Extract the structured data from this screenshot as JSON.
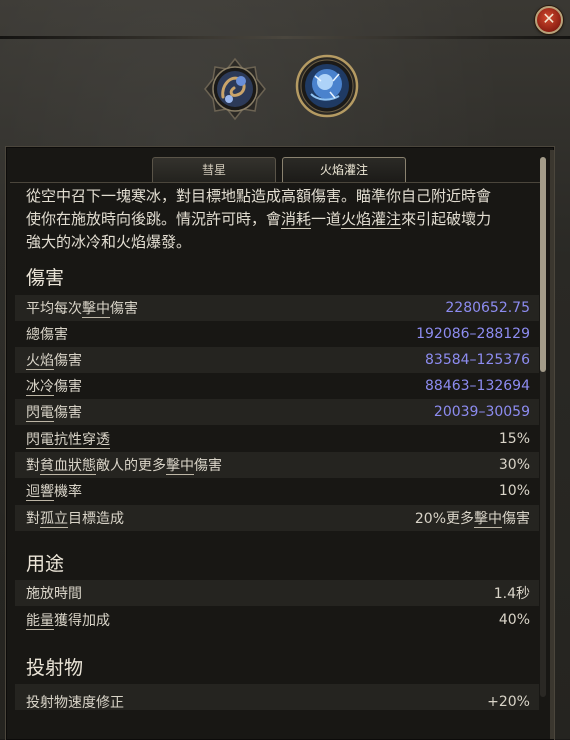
{
  "window": {
    "close_glyph": "✕"
  },
  "gems": [
    {
      "icon": "ice-serpent-gem-icon"
    },
    {
      "icon": "frost-orb-gem-icon"
    }
  ],
  "tabs": [
    {
      "label": "彗星",
      "active": false
    },
    {
      "label": "火焰灌注",
      "active": true
    }
  ],
  "description": {
    "line1": "從空中召下一塊寒冰，對目標地點造成高額傷害。瞄準你自己附近時會",
    "line2": "使你在施放時向後跳。情況許可時，會",
    "kw1": "消耗",
    "mid": "一道",
    "kw2": "火焰灌注",
    "line2_end": "來引起破壞力",
    "line3": "強大的冰冷和火焰爆發。"
  },
  "sections": {
    "damage": {
      "title": "傷害",
      "rows": [
        {
          "label_a": "平均每次",
          "label_u": "擊中",
          "label_b": "傷害",
          "value": "2280652.75"
        },
        {
          "label_a": "總傷害",
          "label_u": "",
          "label_b": "",
          "value": "192086–288129"
        },
        {
          "label_a": "",
          "label_u": "火焰",
          "label_b": "傷害",
          "value": "83584–125376"
        },
        {
          "label_a": "",
          "label_u": "冰冷",
          "label_b": "傷害",
          "value": "88463–132694"
        },
        {
          "label_a": "",
          "label_u": "閃電",
          "label_b": "傷害",
          "value": "20039–30059"
        },
        {
          "label_a": "",
          "label_u": "閃電抗性穿透",
          "label_b": "",
          "value": "15%"
        },
        {
          "label_a": "對",
          "label_u": "貧血狀態",
          "label_b": "敵人的更多",
          "label_u2": "擊中",
          "label_c": "傷害",
          "value": "30%"
        },
        {
          "label_a": "",
          "label_u": "迴響",
          "label_b": "機率",
          "value": "10%"
        },
        {
          "label_a": "對",
          "label_u": "孤立",
          "label_b": "目標造成",
          "value_a": "20%更多",
          "value_u": "擊中",
          "value_b": "傷害"
        }
      ]
    },
    "usage": {
      "title": "用途",
      "rows": [
        {
          "label_a": "施放時間",
          "value": "1.4秒"
        },
        {
          "label_u": "能量",
          "label_b": "獲得加成",
          "value": "40%"
        }
      ]
    },
    "projectile": {
      "title": "投射物",
      "partial_row_label": "投射物速度修正",
      "partial_row_value": "+20%"
    }
  },
  "colors": {
    "damage_value_blue": "#8d8cf0",
    "close_button_red": "#c0392b",
    "text_main": "#d9d4c8"
  }
}
